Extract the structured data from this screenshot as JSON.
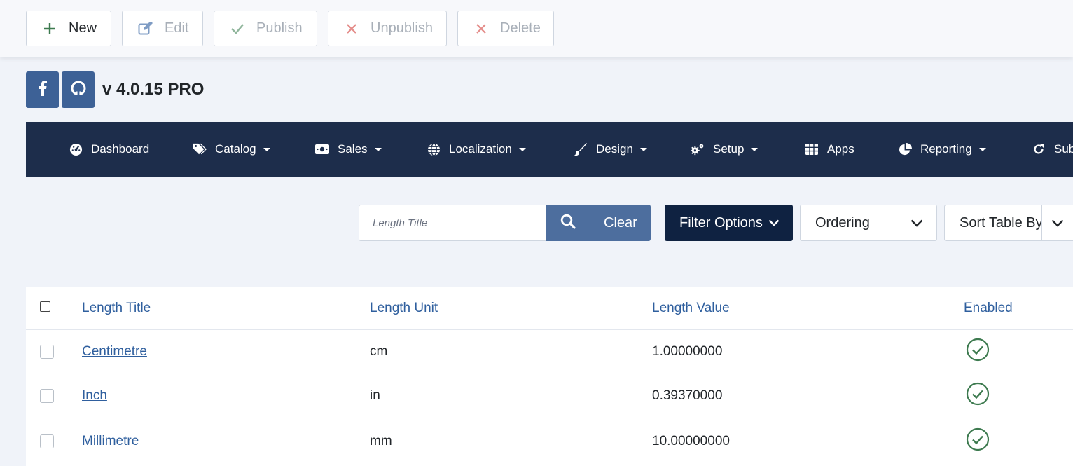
{
  "toolbar": {
    "new_label": "New",
    "edit_label": "Edit",
    "publish_label": "Publish",
    "unpublish_label": "Unpublish",
    "delete_label": "Delete"
  },
  "header": {
    "version": "v 4.0.15 PRO",
    "social": [
      "facebook-icon",
      "github-icon"
    ]
  },
  "nav": {
    "items": [
      {
        "label": "Dashboard",
        "icon": "dashboard-icon",
        "dropdown": false
      },
      {
        "label": "Catalog",
        "icon": "tags-icon",
        "dropdown": true
      },
      {
        "label": "Sales",
        "icon": "money-icon",
        "dropdown": true
      },
      {
        "label": "Localization",
        "icon": "globe-icon",
        "dropdown": true
      },
      {
        "label": "Design",
        "icon": "paintbrush-icon",
        "dropdown": true
      },
      {
        "label": "Setup",
        "icon": "gears-icon",
        "dropdown": true
      },
      {
        "label": "Apps",
        "icon": "grid-icon",
        "dropdown": false
      },
      {
        "label": "Reporting",
        "icon": "pie-chart-icon",
        "dropdown": true
      },
      {
        "label": "Sub",
        "icon": "refresh-icon",
        "dropdown": false
      }
    ]
  },
  "filters": {
    "search_placeholder": "Length Title",
    "clear_label": "Clear",
    "filter_options_label": "Filter Options",
    "ordering_label": "Ordering",
    "sort_label": "Sort Table By"
  },
  "table": {
    "columns": [
      "Length Title",
      "Length Unit",
      "Length Value",
      "Enabled"
    ],
    "rows": [
      {
        "title": "Centimetre",
        "unit": "cm",
        "value": "1.00000000",
        "enabled": true
      },
      {
        "title": "Inch",
        "unit": "in",
        "value": "0.39370000",
        "enabled": true
      },
      {
        "title": "Millimetre",
        "unit": "mm",
        "value": "10.00000000",
        "enabled": true
      }
    ]
  },
  "colors": {
    "nav_bg": "#1d2d4b",
    "accent": "#4d6e9e",
    "filter_btn": "#0f2241",
    "link": "#2f5f9e",
    "success": "#3d7a4f",
    "danger": "#d9534f"
  }
}
